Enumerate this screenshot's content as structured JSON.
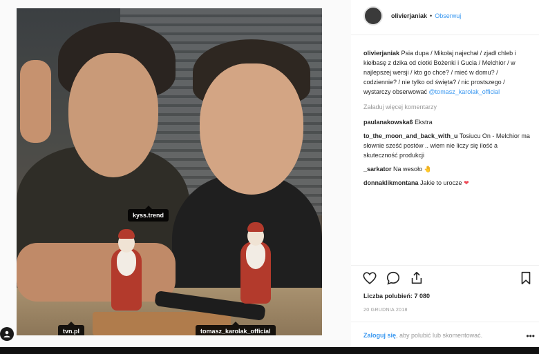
{
  "post": {
    "photo_tags": [
      {
        "label": "kyss.trend"
      },
      {
        "label": "tvn.pl"
      },
      {
        "label": "tomasz_karolak_official"
      }
    ]
  },
  "header": {
    "username": "olivierjaniak",
    "separator": "•",
    "follow_label": "Obserwuj"
  },
  "caption": {
    "username": "olivierjaniak",
    "text": "Psia dupa / Mikołaj najechał / zjadł chleb i kiełbasę z dzika od ciotki Bożenki i Gucia / Melchior / w najlepszej wersji / kto go chce? / mieć w domu? / codziennie? / nie tylko od święta? / nic prostszego / wystarczy obserwować",
    "mention": "@tomasz_karolak_official"
  },
  "load_more": "Załaduj więcej komentarzy",
  "comments": [
    {
      "user": "paulanakowska6",
      "text": "Ekstra",
      "emoji": ""
    },
    {
      "user": "to_the_moon_and_back_with_u",
      "text": "Tosiucu On - Melchior ma słownie sześć postów .. wiem nie liczy się ilość a skuteczność produkcji",
      "emoji": ""
    },
    {
      "user": "_sarkator",
      "text": "Na wesoło",
      "emoji": "🤚"
    },
    {
      "user": "donnaklikmontana",
      "text": "Jakie to urocze",
      "emoji": "❤"
    }
  ],
  "actions": {
    "like_icon": "heart-outline-icon",
    "comment_icon": "comment-bubble-icon",
    "share_icon": "share-arrow-icon",
    "save_icon": "bookmark-icon"
  },
  "likes": "Liczba polubień: 7 080",
  "date": "20 GRUDNIA 2018",
  "login": {
    "link": "Zaloguj się",
    "rest": ", aby polubić lub skomentować."
  },
  "more": "•••",
  "colors": {
    "link_blue": "#3897f0",
    "heart_red": "#ed4956",
    "muted_gray": "#999999"
  }
}
